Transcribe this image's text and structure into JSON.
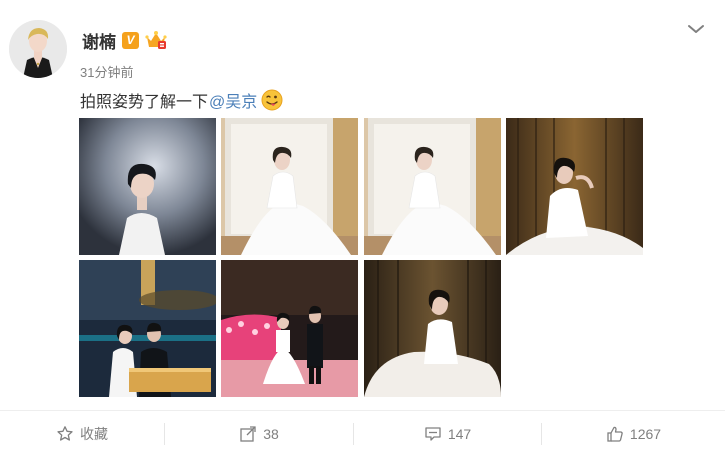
{
  "post": {
    "author_name": "谢楠",
    "verified_badge": "V",
    "time": "31分钟前",
    "text": "拍照姿势了解一下",
    "mention": "@吴京",
    "emoji": "tongue-out-emoji",
    "menu_icon": "chevron-down-icon"
  },
  "photos_count": 7,
  "actions": {
    "favorite_label": "收藏",
    "repost_count": "38",
    "comment_count": "147",
    "like_count": "1267"
  },
  "colors": {
    "link": "#4b7fb8",
    "verified": "#f5a11c",
    "muted": "#808080"
  }
}
